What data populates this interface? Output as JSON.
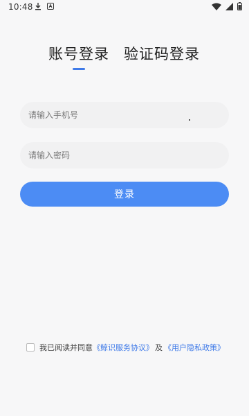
{
  "status_bar": {
    "time": "10:48",
    "icons_left": [
      "download-icon",
      "app-notification-icon"
    ],
    "icons_right": [
      "wifi-icon",
      "signal-icon",
      "battery-icon"
    ]
  },
  "tabs": [
    {
      "label": "账号登录",
      "active": true
    },
    {
      "label": "验证码登录",
      "active": false
    }
  ],
  "form": {
    "phone_placeholder": "请输入手机号",
    "password_placeholder": "请输入密码",
    "login_label": "登录"
  },
  "agreement": {
    "prefix": "我已阅读并同意",
    "service_link": "《鲸识服务协议》",
    "and": "及",
    "privacy_link": "《用户隐私政策》"
  },
  "colors": {
    "accent": "#3f7ae8",
    "button": "#4c8cf4",
    "background": "#f7f7f8",
    "input_bg": "#f1f1f2"
  }
}
